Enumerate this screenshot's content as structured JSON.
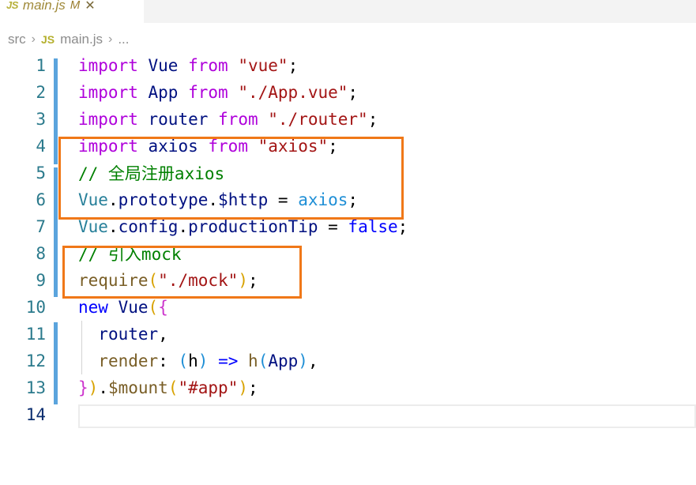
{
  "window": {
    "app": "code-editor",
    "background": "#ffffff"
  },
  "tab": {
    "icon": "js-file-icon",
    "label": "main.js",
    "dirty_marker": "M",
    "close_glyph": "✕"
  },
  "breadcrumb": {
    "items": [
      {
        "label": "src",
        "kind": "folder"
      },
      {
        "label": "main.js",
        "kind": "file",
        "icon": "js-file-icon"
      },
      {
        "label": "...",
        "kind": "symbols"
      }
    ],
    "separator": "›"
  },
  "editor": {
    "language": "javascript",
    "active_line": 14,
    "line_numbers": [
      "1",
      "2",
      "3",
      "4",
      "5",
      "6",
      "7",
      "8",
      "9",
      "10",
      "11",
      "12",
      "13",
      "14"
    ],
    "lines": [
      {
        "n": "1",
        "text": "import Vue from \"vue\";"
      },
      {
        "n": "2",
        "text": "import App from \"./App.vue\";"
      },
      {
        "n": "3",
        "text": "import router from \"./router\";"
      },
      {
        "n": "4",
        "text": "import axios from \"axios\";"
      },
      {
        "n": "5",
        "text": "// 全局注册axios"
      },
      {
        "n": "6",
        "text": "Vue.prototype.$http = axios;"
      },
      {
        "n": "7",
        "text": "Vue.config.productionTip = false;"
      },
      {
        "n": "8",
        "text": "// 引入mock"
      },
      {
        "n": "9",
        "text": "require(\"./mock\");"
      },
      {
        "n": "10",
        "text": "new Vue({"
      },
      {
        "n": "11",
        "text": "  router,"
      },
      {
        "n": "12",
        "text": "  render: (h) => h(App),"
      },
      {
        "n": "13",
        "text": "}).$mount(\"#app\");"
      },
      {
        "n": "14",
        "text": ""
      }
    ],
    "tokens": {
      "l1": [
        [
          "import",
          "t-kw"
        ],
        [
          " ",
          "t-plain"
        ],
        [
          "Vue",
          "t-var"
        ],
        [
          " ",
          "t-plain"
        ],
        [
          "from",
          "t-kw"
        ],
        [
          " ",
          "t-plain"
        ],
        [
          "\"vue\"",
          "t-str"
        ],
        [
          ";",
          "t-plain"
        ]
      ],
      "l2": [
        [
          "import",
          "t-kw"
        ],
        [
          " ",
          "t-plain"
        ],
        [
          "App",
          "t-var"
        ],
        [
          " ",
          "t-plain"
        ],
        [
          "from",
          "t-kw"
        ],
        [
          " ",
          "t-plain"
        ],
        [
          "\"./App.vue\"",
          "t-str"
        ],
        [
          ";",
          "t-plain"
        ]
      ],
      "l3": [
        [
          "import",
          "t-kw"
        ],
        [
          " ",
          "t-plain"
        ],
        [
          "router",
          "t-var"
        ],
        [
          " ",
          "t-plain"
        ],
        [
          "from",
          "t-kw"
        ],
        [
          " ",
          "t-plain"
        ],
        [
          "\"./router\"",
          "t-str"
        ],
        [
          ";",
          "t-plain"
        ]
      ],
      "l4": [
        [
          "import",
          "t-kw"
        ],
        [
          " ",
          "t-plain"
        ],
        [
          "axios",
          "t-var"
        ],
        [
          " ",
          "t-plain"
        ],
        [
          "from",
          "t-kw"
        ],
        [
          " ",
          "t-plain"
        ],
        [
          "\"axios\"",
          "t-str"
        ],
        [
          ";",
          "t-plain"
        ]
      ],
      "l5": [
        [
          "// 全局注册axios",
          "t-com"
        ]
      ],
      "l6": [
        [
          "Vue",
          "t-type"
        ],
        [
          ".",
          "t-plain"
        ],
        [
          "prototype",
          "t-prop"
        ],
        [
          ".",
          "t-plain"
        ],
        [
          "$http",
          "t-prop"
        ],
        [
          " = ",
          "t-plain"
        ],
        [
          "axios",
          "t-param"
        ],
        [
          ";",
          "t-plain"
        ]
      ],
      "l7": [
        [
          "Vue",
          "t-type"
        ],
        [
          ".",
          "t-plain"
        ],
        [
          "config",
          "t-prop"
        ],
        [
          ".",
          "t-plain"
        ],
        [
          "productionTip",
          "t-prop"
        ],
        [
          " = ",
          "t-plain"
        ],
        [
          "false",
          "t-const"
        ],
        [
          ";",
          "t-plain"
        ]
      ],
      "l8": [
        [
          "// 引入mock",
          "t-com"
        ]
      ],
      "l9": [
        [
          "require",
          "t-fn"
        ],
        [
          "(",
          "t-paren1"
        ],
        [
          "\"./mock\"",
          "t-str"
        ],
        [
          ")",
          "t-paren1"
        ],
        [
          ";",
          "t-plain"
        ]
      ],
      "l10": [
        [
          "new",
          "t-const"
        ],
        [
          " ",
          "t-plain"
        ],
        [
          "Vue",
          "t-var"
        ],
        [
          "(",
          "t-paren1"
        ],
        [
          "{",
          "t-paren2"
        ]
      ],
      "l11": [
        [
          "  ",
          "t-plain"
        ],
        [
          "router",
          "t-var"
        ],
        [
          ",",
          "t-plain"
        ]
      ],
      "l12": [
        [
          "  ",
          "t-plain"
        ],
        [
          "render",
          "t-fn"
        ],
        [
          ": ",
          "t-plain"
        ],
        [
          "(",
          "t-param"
        ],
        [
          "h",
          "t-plain"
        ],
        [
          ")",
          "t-param"
        ],
        [
          " ",
          "t-plain"
        ],
        [
          "=>",
          "t-const"
        ],
        [
          " ",
          "t-plain"
        ],
        [
          "h",
          "t-fn"
        ],
        [
          "(",
          "t-param"
        ],
        [
          "App",
          "t-var"
        ],
        [
          ")",
          "t-param"
        ],
        [
          ",",
          "t-plain"
        ]
      ],
      "l13": [
        [
          "}",
          "t-paren2"
        ],
        [
          ")",
          "t-paren1"
        ],
        [
          ".",
          "t-plain"
        ],
        [
          "$mount",
          "t-fn"
        ],
        [
          "(",
          "t-paren1"
        ],
        [
          "\"#app\"",
          "t-str"
        ],
        [
          ")",
          "t-paren1"
        ],
        [
          ";",
          "t-plain"
        ]
      ],
      "l14": []
    }
  },
  "annotations": {
    "color": "#f07818",
    "boxes": [
      {
        "id": "annot-1",
        "covers_lines": "4-6",
        "note": "axios global registration block"
      },
      {
        "id": "annot-2",
        "covers_lines": "8-9",
        "note": "mock require block"
      }
    ]
  },
  "gutter": {
    "modified_indicator_color": "#5ba4dd",
    "indicator_lines": "1-13"
  }
}
